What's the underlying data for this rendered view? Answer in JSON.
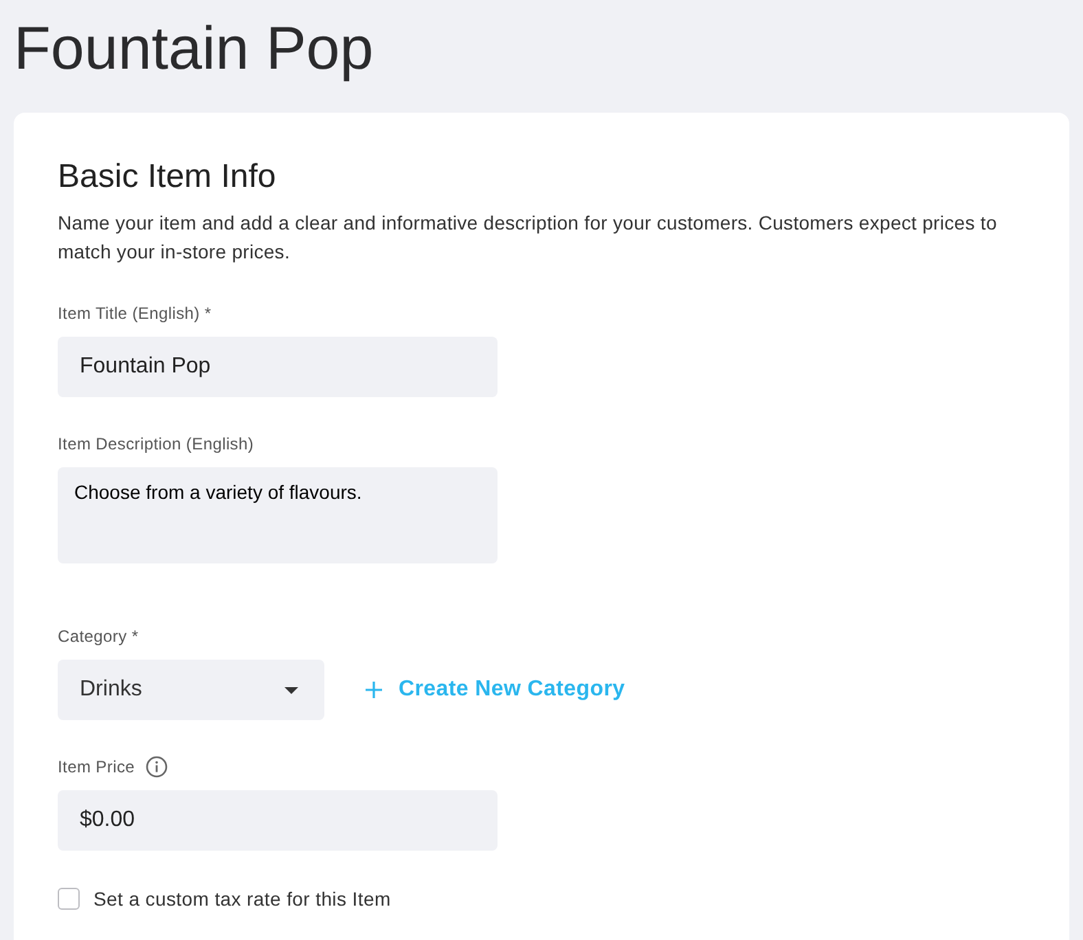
{
  "page": {
    "title": "Fountain Pop"
  },
  "section": {
    "title": "Basic Item Info",
    "description": "Name your item and add a clear and informative description for your customers. Customers expect prices to match your in-store prices."
  },
  "fields": [
    {
      "kind": "text",
      "label": "Item Title (English) *",
      "info": false,
      "value": "Fountain Pop"
    },
    {
      "kind": "textarea",
      "label": "Item Description (English)",
      "info": false,
      "value": "Choose from a variety of flavours."
    },
    {
      "kind": "select",
      "label": "Category *",
      "info": false,
      "value": "Drinks",
      "action": "Create New Category"
    },
    {
      "kind": "text",
      "label": "Item Price",
      "info": true,
      "value": "$0.00"
    }
  ],
  "tax_checkbox": {
    "label": "Set a custom tax rate for this Item",
    "checked": false
  }
}
